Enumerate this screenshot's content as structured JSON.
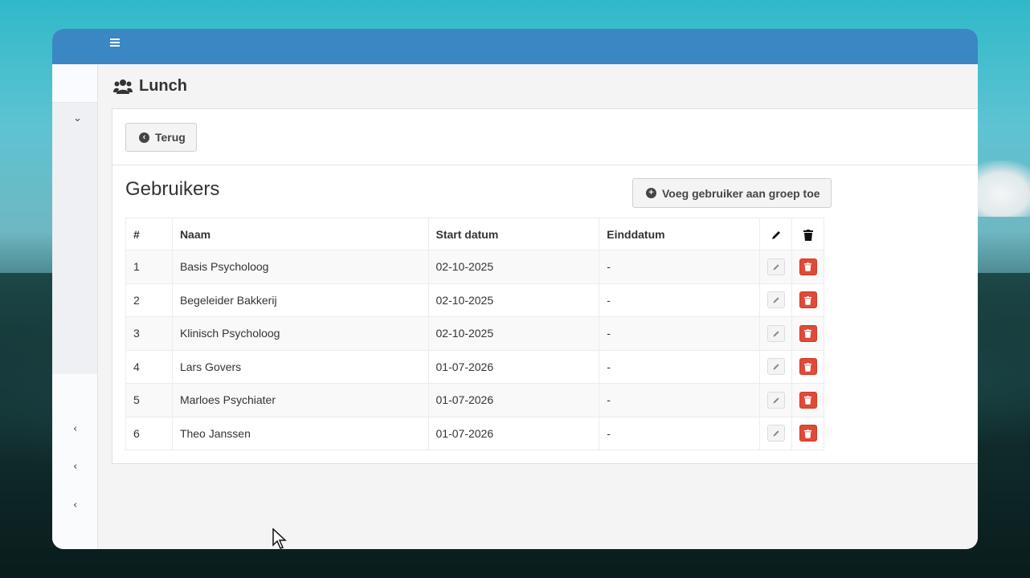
{
  "page": {
    "title": "Lunch"
  },
  "toolbar": {
    "back_label": "Terug"
  },
  "section": {
    "title": "Gebruikers",
    "add_label": "Voeg gebruiker aan groep toe"
  },
  "table": {
    "headers": {
      "num": "#",
      "naam": "Naam",
      "start": "Start datum",
      "eind": "Einddatum"
    },
    "rows": [
      {
        "num": "1",
        "naam": "Basis Psycholoog",
        "start": "02-10-2025",
        "eind": "-"
      },
      {
        "num": "2",
        "naam": "Begeleider Bakkerij",
        "start": "02-10-2025",
        "eind": "-"
      },
      {
        "num": "3",
        "naam": "Klinisch Psycholoog",
        "start": "02-10-2025",
        "eind": "-"
      },
      {
        "num": "4",
        "naam": "Lars Govers",
        "start": "01-07-2026",
        "eind": "-"
      },
      {
        "num": "5",
        "naam": "Marloes Psychiater",
        "start": "01-07-2026",
        "eind": "-"
      },
      {
        "num": "6",
        "naam": "Theo Janssen",
        "start": "01-07-2026",
        "eind": "-"
      }
    ]
  },
  "icons": {
    "menu": "hamburger-icon",
    "title": "users-icon",
    "back": "arrow-circle-left-icon",
    "add": "plus-circle-icon",
    "edit": "pencil-icon",
    "delete": "trash-icon"
  },
  "colors": {
    "topbar": "#3a87c4",
    "danger": "#dd4b39"
  }
}
